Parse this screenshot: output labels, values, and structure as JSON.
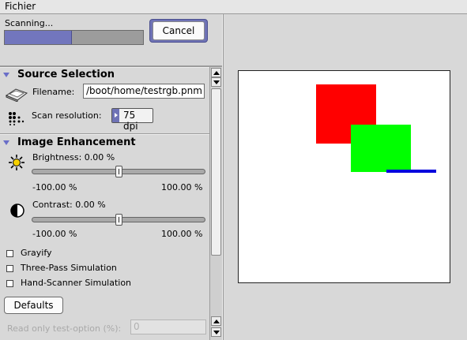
{
  "menubar": {
    "menu_label": "Fichier"
  },
  "scan": {
    "status": "Scanning...",
    "progress_fraction": 0.48,
    "cancel_label": "Cancel"
  },
  "source": {
    "title": "Source Selection",
    "filename_label": "Filename:",
    "filename_value": "/boot/home/testrgb.pnm",
    "resolution_label": "Scan resolution:",
    "resolution_value": "75 dpi"
  },
  "enhancement": {
    "title": "Image Enhancement",
    "brightness_label": "Brightness: 0.00 %",
    "brightness_min": "-100.00 %",
    "brightness_max": "100.00 %",
    "brightness_value_fraction": 0.5,
    "contrast_label": "Contrast: 0.00 %",
    "contrast_min": "-100.00 %",
    "contrast_max": "100.00 %",
    "contrast_value_fraction": 0.5
  },
  "options": {
    "grayify": "Grayify",
    "three_pass": "Three-Pass Simulation",
    "hand_scanner": "Hand-Scanner Simulation",
    "defaults_label": "Defaults",
    "readonly_label": "Read only test-option (%):",
    "readonly_value": "0"
  },
  "colors": {
    "accent": "#7276bd",
    "preview_red": "#ff0000",
    "preview_green": "#00ff00",
    "preview_blue": "#0000dd"
  }
}
